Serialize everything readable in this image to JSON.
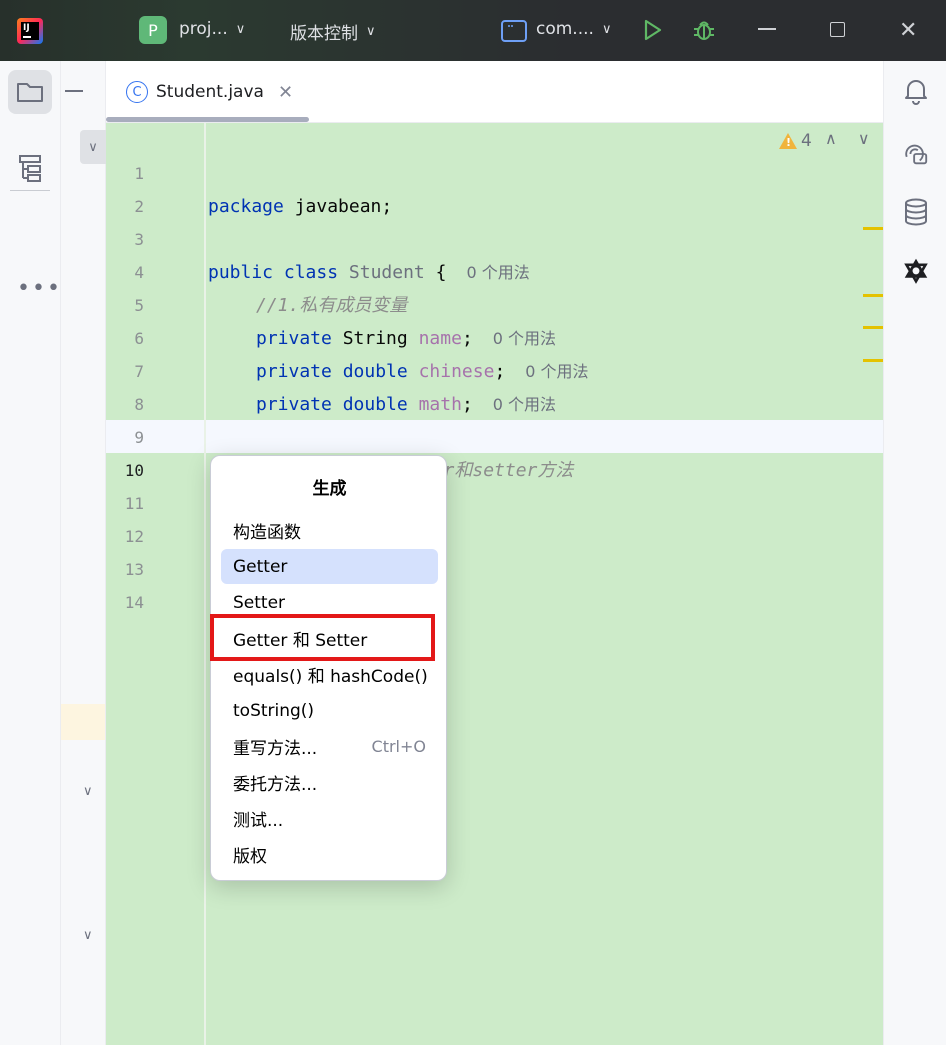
{
  "titlebar": {
    "project_badge": "P",
    "project_name": "proj...",
    "vcs_label": "版本控制",
    "run_config": "com...."
  },
  "tab": {
    "filename": "Student.java",
    "icon_letter": "C"
  },
  "editor": {
    "warnings_count": "4",
    "lines": [
      {
        "n": "1"
      },
      {
        "n": "2"
      },
      {
        "n": "3"
      },
      {
        "n": "4"
      },
      {
        "n": "5"
      },
      {
        "n": "6"
      },
      {
        "n": "7"
      },
      {
        "n": "8"
      },
      {
        "n": "9"
      },
      {
        "n": "10"
      },
      {
        "n": "11"
      },
      {
        "n": "12"
      },
      {
        "n": "13"
      },
      {
        "n": "14"
      }
    ],
    "code": {
      "l1_kw": "package",
      "l1_rest": " javabean;",
      "l3_kw1": "public",
      "l3_kw2": "class",
      "l3_name": "Student",
      "l3_brace": " {",
      "l3_hint": "0 个用法",
      "l4_comment": "//1.私有成员变量",
      "l5_kw": "private",
      "l5_type": "String",
      "l5_field": "name",
      "l5_semi": ";",
      "l5_hint": "0 个用法",
      "l6_kw": "private",
      "l6_type": "double",
      "l6_field": "chinese",
      "l6_semi": ";",
      "l6_hint": "0 个用法",
      "l7_kw": "private",
      "l7_type": "double",
      "l7_field": "math",
      "l7_semi": ";",
      "l7_hint": "0 个用法",
      "l9_comment": "//2.提供公开的getter和setter方法"
    }
  },
  "popup": {
    "title": "生成",
    "items": [
      {
        "label": "构造函数",
        "shortcut": ""
      },
      {
        "label": "Getter",
        "shortcut": ""
      },
      {
        "label": "Setter",
        "shortcut": ""
      },
      {
        "label": "Getter 和 Setter",
        "shortcut": ""
      },
      {
        "label": "equals() 和 hashCode()",
        "shortcut": ""
      },
      {
        "label": "toString()",
        "shortcut": ""
      },
      {
        "label": "重写方法...",
        "shortcut": "Ctrl+O"
      },
      {
        "label": "委托方法...",
        "shortcut": ""
      },
      {
        "label": "测试...",
        "shortcut": ""
      },
      {
        "label": "版权",
        "shortcut": ""
      }
    ],
    "selected_index": 1,
    "highlighted_index": 3
  },
  "colors": {
    "editor_bg": "#cdebc9",
    "keyword": "#0033b3",
    "selection": "#d5e1fd",
    "annotation_red": "#e31818"
  },
  "icons": {
    "left": [
      "folder-icon",
      "structure-icon",
      "more-icon"
    ],
    "right": [
      "notifications-icon",
      "ai-chat-icon",
      "database-icon",
      "plugin-icon"
    ]
  }
}
